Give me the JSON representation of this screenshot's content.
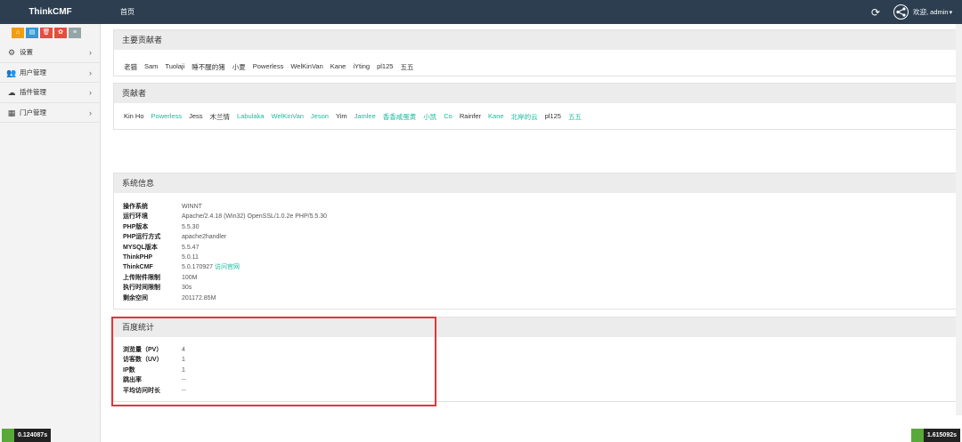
{
  "navbar": {
    "brand": "ThinkCMF",
    "home": "首页",
    "user_label": "欢迎, admin",
    "caret": "▾"
  },
  "sidebar": {
    "shortcuts": [
      {
        "icon": "home-icon",
        "color": "#f39c12"
      },
      {
        "icon": "file-icon",
        "color": "#3498db"
      },
      {
        "icon": "trash-icon",
        "color": "#e74c3c"
      },
      {
        "icon": "settings-icon",
        "color": "#e74c3c"
      },
      {
        "icon": "list-icon",
        "color": "#95a5a6"
      }
    ],
    "items": [
      {
        "label": "设置",
        "icon": "gears-icon"
      },
      {
        "label": "用户管理",
        "icon": "users-icon"
      },
      {
        "label": "插件管理",
        "icon": "cloud-icon"
      },
      {
        "label": "门户管理",
        "icon": "grid-icon"
      }
    ]
  },
  "timers": {
    "left": "0.124087s",
    "right": "1.615092s"
  },
  "main_contributors": {
    "title": "主要贡献者",
    "names": [
      "老猫",
      "Sam",
      "Tuolaji",
      "睡不醒的猪",
      "小夏",
      "Powerless",
      "WelKinVan",
      "Kane",
      "iYting",
      "pl125",
      "五五"
    ]
  },
  "contributors": {
    "title": "贡献者",
    "names": [
      {
        "name": "Kin Ho",
        "link": false
      },
      {
        "name": "Powerless",
        "link": true
      },
      {
        "name": "Jess",
        "link": false
      },
      {
        "name": "木兰情",
        "link": false
      },
      {
        "name": "Labulaka",
        "link": true
      },
      {
        "name": "WelKinVan",
        "link": true
      },
      {
        "name": "Jeson",
        "link": true
      },
      {
        "name": "Yim",
        "link": false
      },
      {
        "name": "Jamlee",
        "link": true
      },
      {
        "name": "香香咸蛋黄",
        "link": true
      },
      {
        "name": "小凯",
        "link": true
      },
      {
        "name": "Co",
        "link": true
      },
      {
        "name": "Rainfer",
        "link": false
      },
      {
        "name": "Kane",
        "link": true
      },
      {
        "name": "北岸的云",
        "link": true
      },
      {
        "name": "pl125",
        "link": false
      },
      {
        "name": "五五",
        "link": true
      }
    ]
  },
  "system_info": {
    "title": "系统信息",
    "rows": [
      {
        "key": "操作系统",
        "value": "WINNT"
      },
      {
        "key": "运行环境",
        "value": "Apache/2.4.18 (Win32) OpenSSL/1.0.2e PHP/5.5.30"
      },
      {
        "key": "PHP版本",
        "value": "5.5.30"
      },
      {
        "key": "PHP运行方式",
        "value": "apache2handler"
      },
      {
        "key": "MYSQL版本",
        "value": "5.5.47"
      },
      {
        "key": "ThinkPHP",
        "value": "5.0.11"
      },
      {
        "key": "ThinkCMF",
        "value": "5.0.170927",
        "link": "访问官网"
      },
      {
        "key": "上传附件限制",
        "value": "100M"
      },
      {
        "key": "执行时间限制",
        "value": "30s"
      },
      {
        "key": "剩余空间",
        "value": "201172.85M"
      }
    ]
  },
  "baidu_stats": {
    "title": "百度统计",
    "rows": [
      {
        "key": "浏览量（PV）",
        "value": "4"
      },
      {
        "key": "访客数（UV）",
        "value": "1"
      },
      {
        "key": "IP数",
        "value": "1"
      },
      {
        "key": "跳出率",
        "value": "--"
      },
      {
        "key": "平均访问时长",
        "value": "--"
      }
    ]
  },
  "colors": {
    "navbar": "#2c3e50",
    "link": "#18bc9c",
    "highlight": "#e0363c"
  }
}
